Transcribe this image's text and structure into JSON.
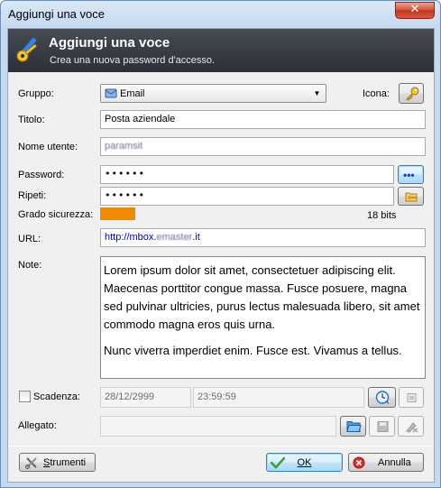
{
  "window": {
    "title": "Aggiungi una voce",
    "close_glyph": "✕"
  },
  "banner": {
    "title": "Aggiungi una voce",
    "subtitle": "Crea una nuova password d'accesso.",
    "icon": "key-pencil-icon"
  },
  "form": {
    "group_label": "Gruppo:",
    "group_value": "Email",
    "icon_label": "Icona:",
    "title_label": "Titolo:",
    "title_value": "Posta aziendale",
    "username_label": "Nome utente:",
    "username_value": "paramsit",
    "password_label": "Password:",
    "password_value": "••••••",
    "repeat_label": "Ripeti:",
    "repeat_value": "••••••",
    "strength_label": "Grado sicurezza:",
    "strength_value": "18 bits",
    "strength_fraction": 0.13,
    "strength_color": "#f08a00",
    "url_label": "URL:",
    "url_value_prefix": "http://mbox.",
    "url_value_blurred": "emaster",
    "url_value_suffix": ".it",
    "notes_label": "Note:",
    "notes_paragraphs": [
      "Lorem ipsum dolor sit amet, consectetuer adipiscing elit. Maecenas porttitor congue massa. Fusce posuere, magna sed pulvinar ultricies, purus lectus malesuada libero, sit amet commodo magna eros quis urna.",
      "Nunc viverra imperdiet enim. Fusce est. Vivamus a tellus."
    ],
    "expiry_label": "Scadenza:",
    "expiry_date": "28/12/2999",
    "expiry_time": "23:59:59",
    "attachment_label": "Allegato:",
    "show_password_glyph": "•••"
  },
  "footer": {
    "tools_label": "Strumenti",
    "ok_label": "OK",
    "cancel_label": "Annulla"
  },
  "colors": {
    "banner": "#2b2f37",
    "accent": "#f08a00",
    "link": "#0000cc"
  }
}
